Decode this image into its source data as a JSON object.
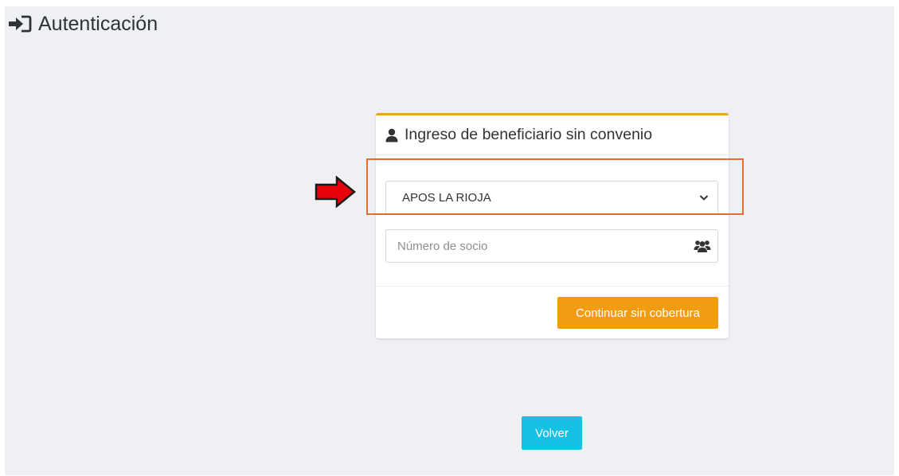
{
  "header": {
    "title": "Autenticación",
    "icon": "sign-in-icon"
  },
  "card": {
    "title": "Ingreso de beneficiario sin convenio",
    "title_icon": "user-icon",
    "accent_color": "#f0a21a",
    "coverage_select": {
      "selected": "APOS LA RIOJA",
      "icon": "chevron-down-icon"
    },
    "member_number": {
      "placeholder": "Número de socio",
      "value": "",
      "icon": "users-icon"
    },
    "continue_button": {
      "label": "Continuar sin cobertura",
      "color": "#f39c12"
    }
  },
  "footer": {
    "back_button": {
      "label": "Volver",
      "color": "#17c1e5"
    }
  },
  "annotation": {
    "highlight_color": "#e36c2e",
    "arrow_color": "#e8000b"
  }
}
